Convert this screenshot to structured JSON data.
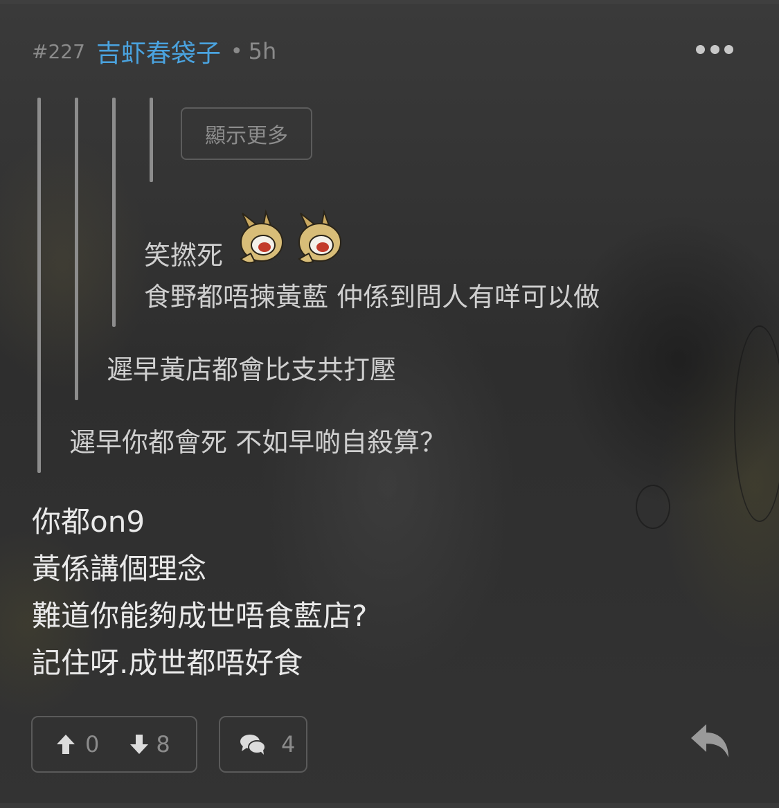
{
  "post": {
    "number": "#227",
    "username": "吉虾春袋子",
    "separator": "•",
    "time": "5h"
  },
  "quotes": {
    "show_more": "顯示更多",
    "level4": {
      "line1": "笑撚死",
      "line2": "食野都唔揀黃藍 仲係到問人有咩可以做"
    },
    "level3": "遲早黃店都會比支共打壓",
    "level2": "遲早你都會死 不如早啲自殺算？"
  },
  "body": {
    "lines": [
      "你都on9",
      "黃係講個理念",
      "難道你能夠成世唔食藍店?",
      "記住呀.成世都唔好食"
    ]
  },
  "actions": {
    "upvotes": "0",
    "downvotes": "8",
    "comments": "4"
  },
  "icons": {
    "more": "more-horizontal-icon",
    "upvote": "arrow-up-icon",
    "downvote": "arrow-down-icon",
    "comment": "comments-icon",
    "reply": "reply-icon",
    "emoji": "laughing-creature-sticker-icon"
  },
  "colors": {
    "username": "#4aa3df",
    "muted": "#8a8a8a",
    "quote_text": "#cfcfcf",
    "body_text": "#e9e9e9",
    "border": "#5a5a5a"
  }
}
